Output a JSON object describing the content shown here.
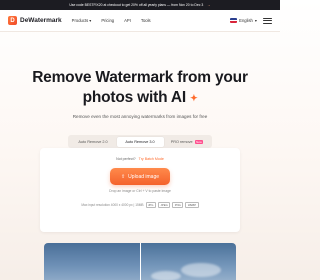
{
  "promo": {
    "text": "Use code BESTFIX20 at checkout to get 20% off all yearly plans — from Nov 20 to Dec 3",
    "arrow": "→"
  },
  "nav": {
    "logo_text": "DeWatermark",
    "logo_glyph": "D",
    "links": [
      "Products",
      "Pricing",
      "API",
      "Tools"
    ],
    "products_chevron": "▾",
    "language": "English",
    "language_chevron": "▾"
  },
  "hero": {
    "title_line1": "Remove Watermark from your",
    "title_line2": "photos with AI",
    "sparkle": "✦",
    "subtitle": "Remove even the most annoying watermarks from images for free"
  },
  "tabs": [
    {
      "label": "Auto Remove 2.0",
      "active": false
    },
    {
      "label": "Auto Remove 3.0",
      "active": true
    },
    {
      "label": "PRO remove",
      "active": false,
      "badge": "New"
    }
  ],
  "upload_card": {
    "hint_prefix": "Not perfect?",
    "hint_link": "Try Batch Mode",
    "button_label": "Upload image",
    "button_icon": "upload-icon",
    "drop_hint": "Drop an image or Ctrl + V to paste image",
    "limits_text": "Max input resolution 4000 x 4000 px | 15MB",
    "formats": [
      "JPG",
      "JPEG",
      "PNG",
      "WEBP"
    ]
  },
  "colors": {
    "accent": "#f4622b",
    "promo_bg": "#1c1c22",
    "badge": "#ff4d8d"
  }
}
